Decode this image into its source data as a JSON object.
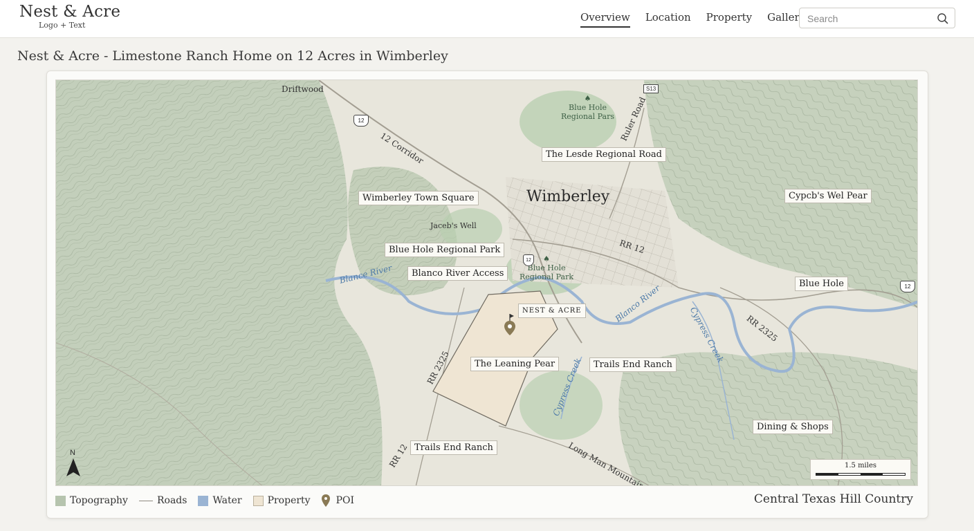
{
  "header": {
    "logo_name": "Nest & Acre",
    "logo_sub": "Logo + Text",
    "nav": [
      "Overview",
      "Location",
      "Property",
      "Gallery"
    ],
    "active_nav": "Overview",
    "search_placeholder": "Search"
  },
  "page_title": "Nest & Acre - Limestone Ranch Home on 12 Acres in Wimberley",
  "map": {
    "town": "Wimberley",
    "place_driftwood": "Driftwood",
    "labels": {
      "leade_road": "The Lesde Regional Road",
      "town_square": "Wimberley Town Square",
      "cypress_pear": "Cypcb's Wel Pear",
      "blue_hole_park": "Blue Hole Regional Park",
      "blanco_access": "Blanco River Access",
      "blue_hole": "Blue Hole",
      "property_sign": "NEST & ACRE",
      "leaning_pear": "The Leaning Pear",
      "trails_end_1": "Trails End Ranch",
      "dining": "Dining & Shops",
      "trails_end_2": "Trails End Ranch"
    },
    "parks": {
      "park_top_1": "Blue Hole",
      "park_top_2": "Regional Pars",
      "park_mid_1": "Blue Hole",
      "park_mid_2": "Regional Park",
      "jacobs_well": "Jaceb's Well"
    },
    "roads": {
      "corridor": "12 Corridor",
      "rr12_east": "RR 12",
      "rr2325_east": "RR 2325",
      "rr2325_west": "RR 2325",
      "rr12_south": "RR 12",
      "long_man": "Long Man Mountain Road",
      "ruler_rd": "Ruler Road"
    },
    "water": {
      "blanco_west": "Blance River",
      "blanco_east": "Blanco River",
      "cypress_creek": "Cypress Creek",
      "cypress_creek_2": "Cypress Creek"
    },
    "shields": {
      "us12_top": "12",
      "s13": "S13",
      "us12_right": "12",
      "r12_mid": "12"
    },
    "scale": "1.5 miles",
    "north": "N"
  },
  "legend": {
    "items": [
      "Topography",
      "Roads",
      "Water",
      "Property",
      "POI"
    ],
    "colors": {
      "topography": "#b6c4ae",
      "water": "#9ab4d3",
      "property": "#efe5d3",
      "poi": "#8a7a55"
    },
    "region": "Central Texas Hill Country"
  }
}
